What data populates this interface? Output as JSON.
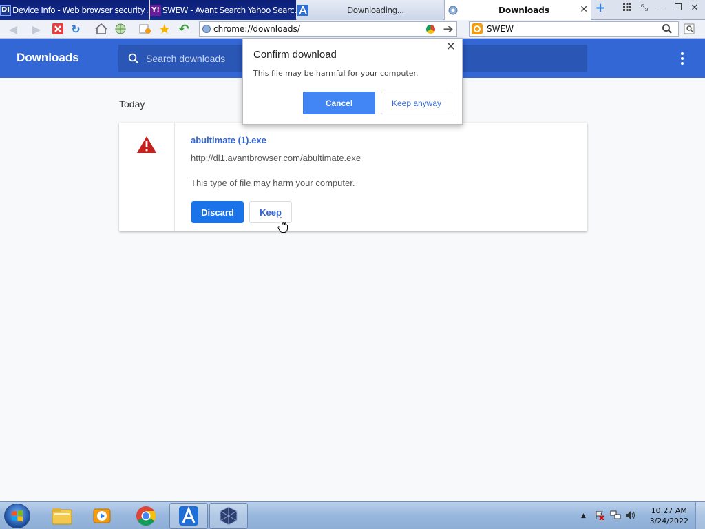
{
  "browser": {
    "tabs": [
      {
        "title": "Device Info - Web browser security...",
        "favicon": "DI"
      },
      {
        "title": "SWEW - Avant Search Yahoo Searc...",
        "favicon": "Y!"
      },
      {
        "title": "Downloading...",
        "favicon": "avant-icon"
      },
      {
        "title": "Downloads",
        "favicon": "chrome-page-icon"
      }
    ],
    "address": "chrome://downloads/",
    "search_box": "SWEW",
    "colors": {
      "tab_inactive": "#0c1f78",
      "header": "#3367d6"
    }
  },
  "downloads_page": {
    "title": "Downloads",
    "search_placeholder": "Search downloads",
    "section_date": "Today",
    "item": {
      "file_name": "abultimate (1).exe",
      "url": "http://dl1.avantbrowser.com/abultimate.exe",
      "warning": "This type of file may harm your computer.",
      "discard_label": "Discard",
      "keep_label": "Keep"
    }
  },
  "dialog": {
    "title": "Confirm download",
    "message": "This file may be harmful for your computer.",
    "cancel_label": "Cancel",
    "keep_label": "Keep anyway"
  },
  "taskbar": {
    "apps": [
      "windows-explorer",
      "media-player",
      "chrome",
      "avant-browser",
      "virtualbox"
    ],
    "time": "10:27 AM",
    "date": "3/24/2022"
  }
}
